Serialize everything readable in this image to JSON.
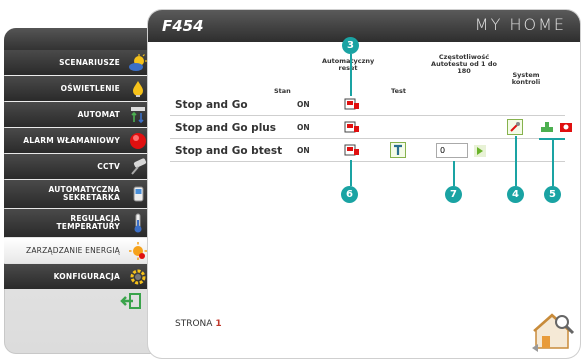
{
  "sidebar": {
    "items": [
      {
        "label": "SCENARIUSZE",
        "icon": "sun-cloud-icon"
      },
      {
        "label": "OŚWIETLENIE",
        "icon": "light-bulb-icon"
      },
      {
        "label": "AUTOMAT",
        "icon": "arrows-updown-icon"
      },
      {
        "label": "ALARM WŁAMANIOWY",
        "icon": "alarm-red-icon"
      },
      {
        "label": "CCTV",
        "icon": "camera-icon"
      },
      {
        "label": "AUTOMATYCZNA SEKRETARKA",
        "icon": "phone-icon"
      },
      {
        "label": "REGULACJA TEMPERATURY",
        "icon": "thermometer-icon"
      },
      {
        "label": "ZARZĄDZANIE ENERGIĄ",
        "icon": "energy-sun-icon"
      },
      {
        "label": "KONFIGURACJA",
        "icon": "gear-icon"
      }
    ],
    "active_index": 7
  },
  "header": {
    "title": "F454",
    "logo": "MY HOME"
  },
  "table": {
    "columns": {
      "stan": "Stan",
      "auto_reset": "Automatyczny reset",
      "test": "Test",
      "frequency": "Częstotliwość Autotestu od 1 do 180",
      "system": "System kontroli"
    },
    "rows": [
      {
        "name": "Stop and Go",
        "state": "ON"
      },
      {
        "name": "Stop and Go plus",
        "state": "ON"
      },
      {
        "name": "Stop and Go btest",
        "state": "ON",
        "frequency_value": "0"
      }
    ]
  },
  "callouts": [
    "3",
    "6",
    "7",
    "4",
    "5"
  ],
  "footer": {
    "page_label": "STRONA",
    "page_number": "1"
  },
  "colors": {
    "accent": "#1aa3a3",
    "dark": "#2e2e2e",
    "page_number": "#c0392b"
  }
}
